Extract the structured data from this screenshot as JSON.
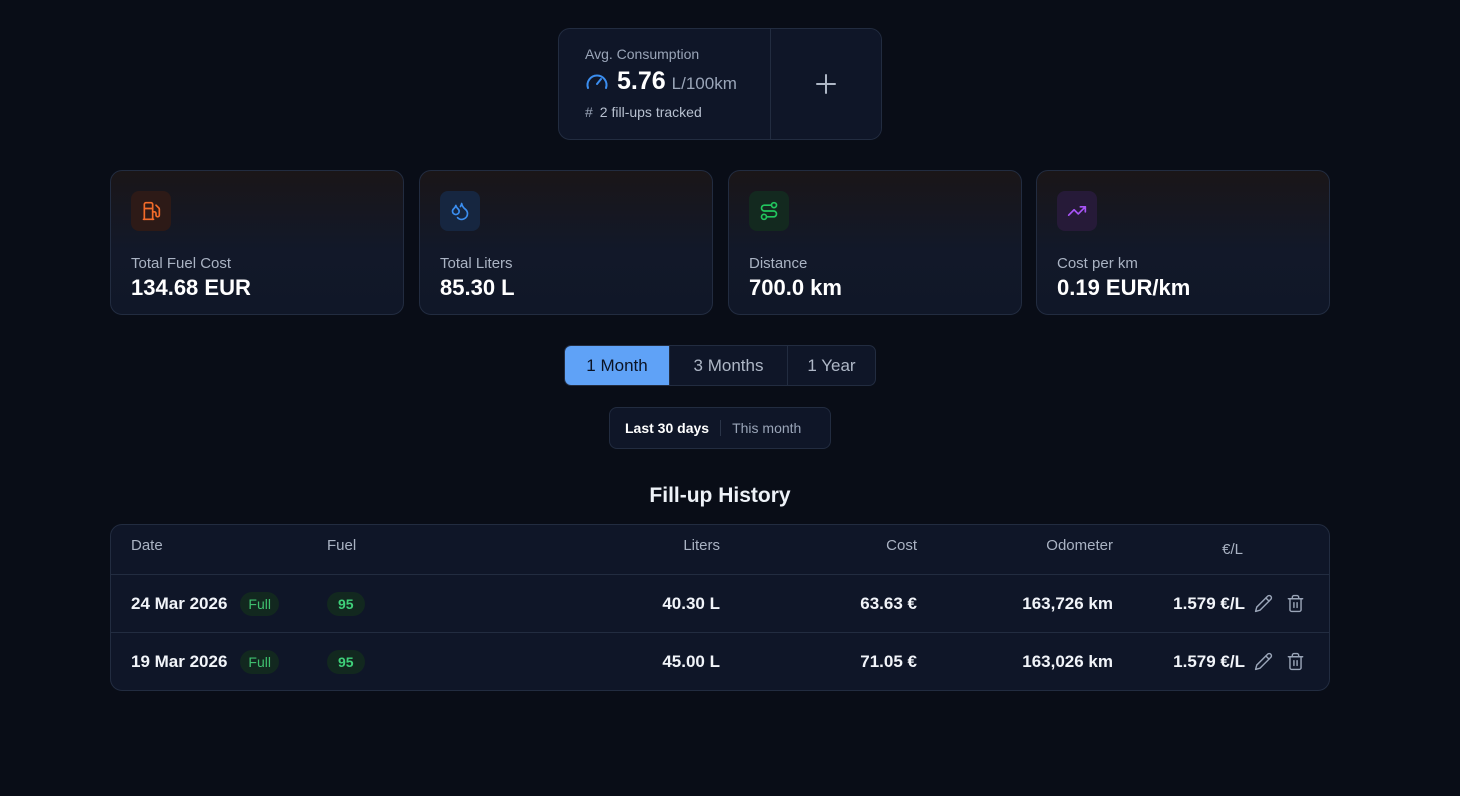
{
  "consumption": {
    "label": "Avg. Consumption",
    "value": "5.76",
    "unit": "L/100km",
    "sub": "2 fill-ups tracked",
    "icon": "gauge-icon",
    "add_icon": "plus-icon"
  },
  "stats": [
    {
      "label": "Total Fuel Cost",
      "value": "134.68 EUR",
      "icon": "fuel-pump-icon",
      "color": "#f26b2a"
    },
    {
      "label": "Total Liters",
      "value": "85.30 L",
      "icon": "droplets-icon",
      "color": "#3b8ef0"
    },
    {
      "label": "Distance",
      "value": "700.0 km",
      "icon": "route-icon",
      "color": "#22c55e"
    },
    {
      "label": "Cost per km",
      "value": "0.19 EUR/km",
      "icon": "trending-up-icon",
      "color": "#a855f7"
    }
  ],
  "periods": {
    "options": [
      "1 Month",
      "3 Months",
      "1 Year"
    ],
    "selected": "1 Month"
  },
  "range": {
    "options": [
      "Last 30 days",
      "This month"
    ],
    "selected": "Last 30 days"
  },
  "history": {
    "title": "Fill-up History",
    "columns": [
      "Date",
      "Fuel",
      "Liters",
      "Cost",
      "Odometer",
      "€/L"
    ],
    "rows": [
      {
        "date": "24 Mar 2026",
        "type": "Full",
        "fuel": "95",
        "liters": "40.30 L",
        "cost": "63.63 €",
        "odometer": "163,726 km",
        "price_per_liter": "1.579 €/L"
      },
      {
        "date": "19 Mar 2026",
        "type": "Full",
        "fuel": "95",
        "liters": "45.00 L",
        "cost": "71.05 €",
        "odometer": "163,026 km",
        "price_per_liter": "1.579 €/L"
      }
    ],
    "row_actions": [
      "pencil-icon",
      "trash-icon"
    ]
  }
}
